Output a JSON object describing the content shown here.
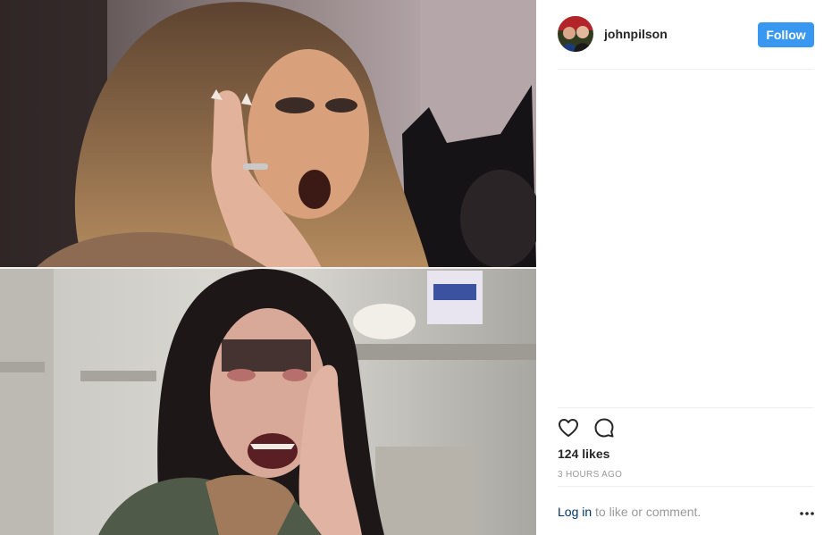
{
  "post": {
    "username": "johnpilson",
    "follow_label": "Follow",
    "likes": "124 likes",
    "timestamp": "3 HOURS AGO",
    "login_link": "Log in",
    "login_suffix": " to like or comment."
  },
  "icons": {
    "like": "heart-outline-icon",
    "comment": "comment-bubble-icon",
    "more": "more-options-icon"
  },
  "colors": {
    "follow_button": "#3897f0",
    "login_link": "#003569",
    "muted_text": "#999999"
  }
}
